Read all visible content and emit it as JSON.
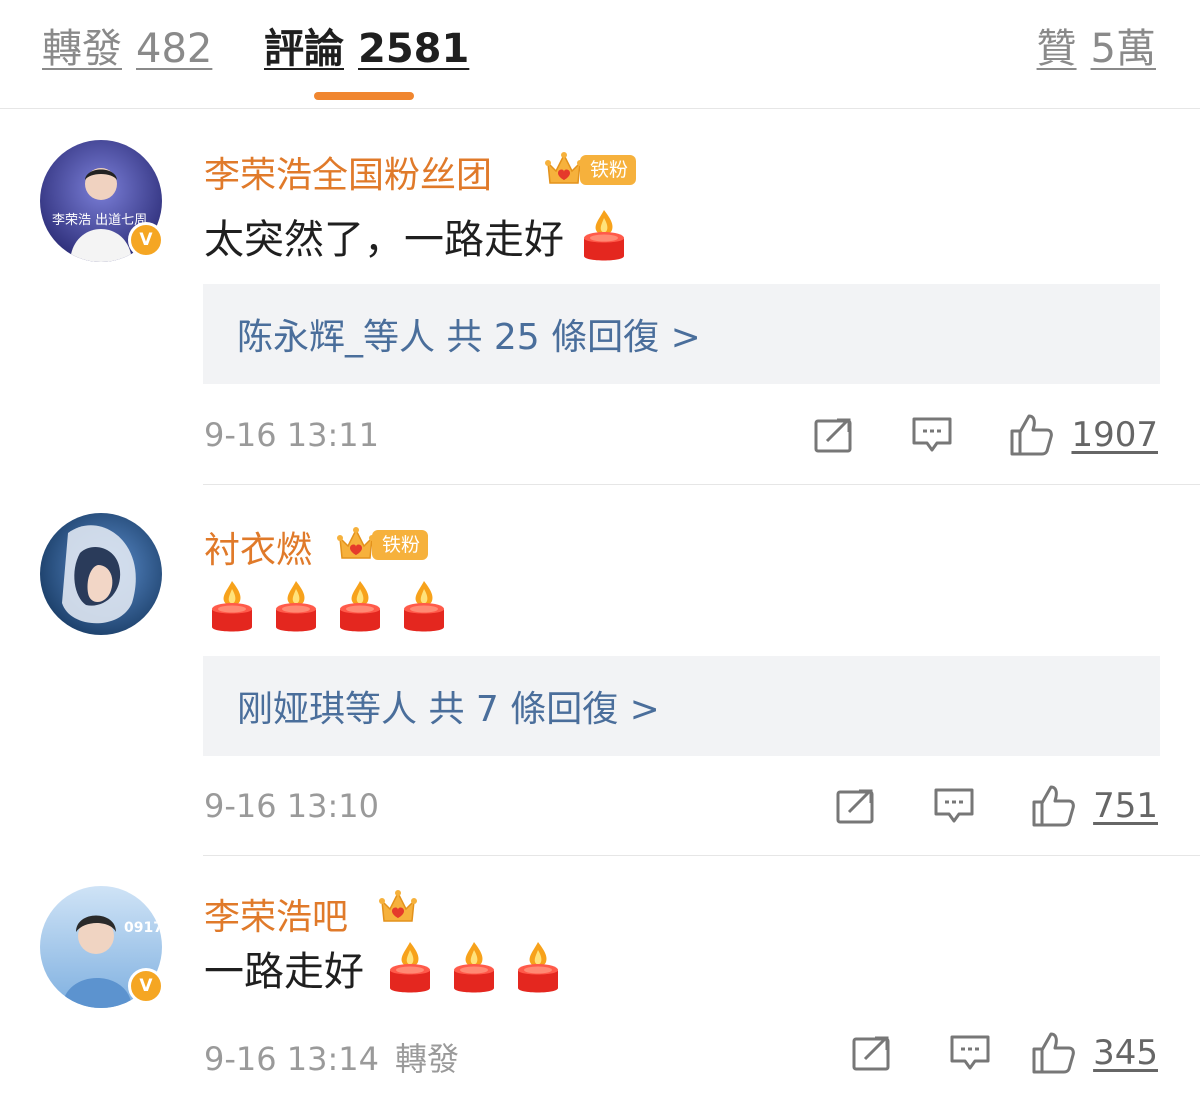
{
  "tabs": {
    "repost": {
      "label": "轉發",
      "count": "482"
    },
    "comment": {
      "label": "評論",
      "count": "2581"
    },
    "like": {
      "label": "贊",
      "count": "5萬"
    }
  },
  "colors": {
    "accent": "#f0862f",
    "username": "#e07a2a",
    "link": "#4a6e9b",
    "badge": "#f6b13c"
  },
  "comments": [
    {
      "username": "李荣浩全国粉丝团",
      "fan_badge": {
        "level": "7",
        "label": "铁粉"
      },
      "verified": true,
      "avatar_text": "李荣浩 出道七周",
      "text": "太突然了，一路走好",
      "candles": 1,
      "replies": {
        "label": "陈永辉_等人 共 25 條回復 >"
      },
      "time": "9-16 13:11",
      "likes": "1907"
    },
    {
      "username": "衬衣燃",
      "fan_badge": {
        "level": "3",
        "label": "铁粉"
      },
      "verified": false,
      "text": "",
      "candles": 4,
      "replies": {
        "label": "刚娅琪等人 共 7 條回復 >"
      },
      "time": "9-16 13:10",
      "likes": "751"
    },
    {
      "username": "李荣浩吧",
      "fan_badge": {
        "level": "6",
        "label": ""
      },
      "verified": true,
      "avatar_text": "0917",
      "text": "一路走好",
      "candles": 3,
      "time": "9-16 13:14",
      "repost_label": "轉發",
      "likes": "345"
    }
  ],
  "icons": [
    "share-icon",
    "comment-icon",
    "thumbs-up-icon",
    "crown-icon",
    "candle-icon",
    "verified-icon"
  ]
}
